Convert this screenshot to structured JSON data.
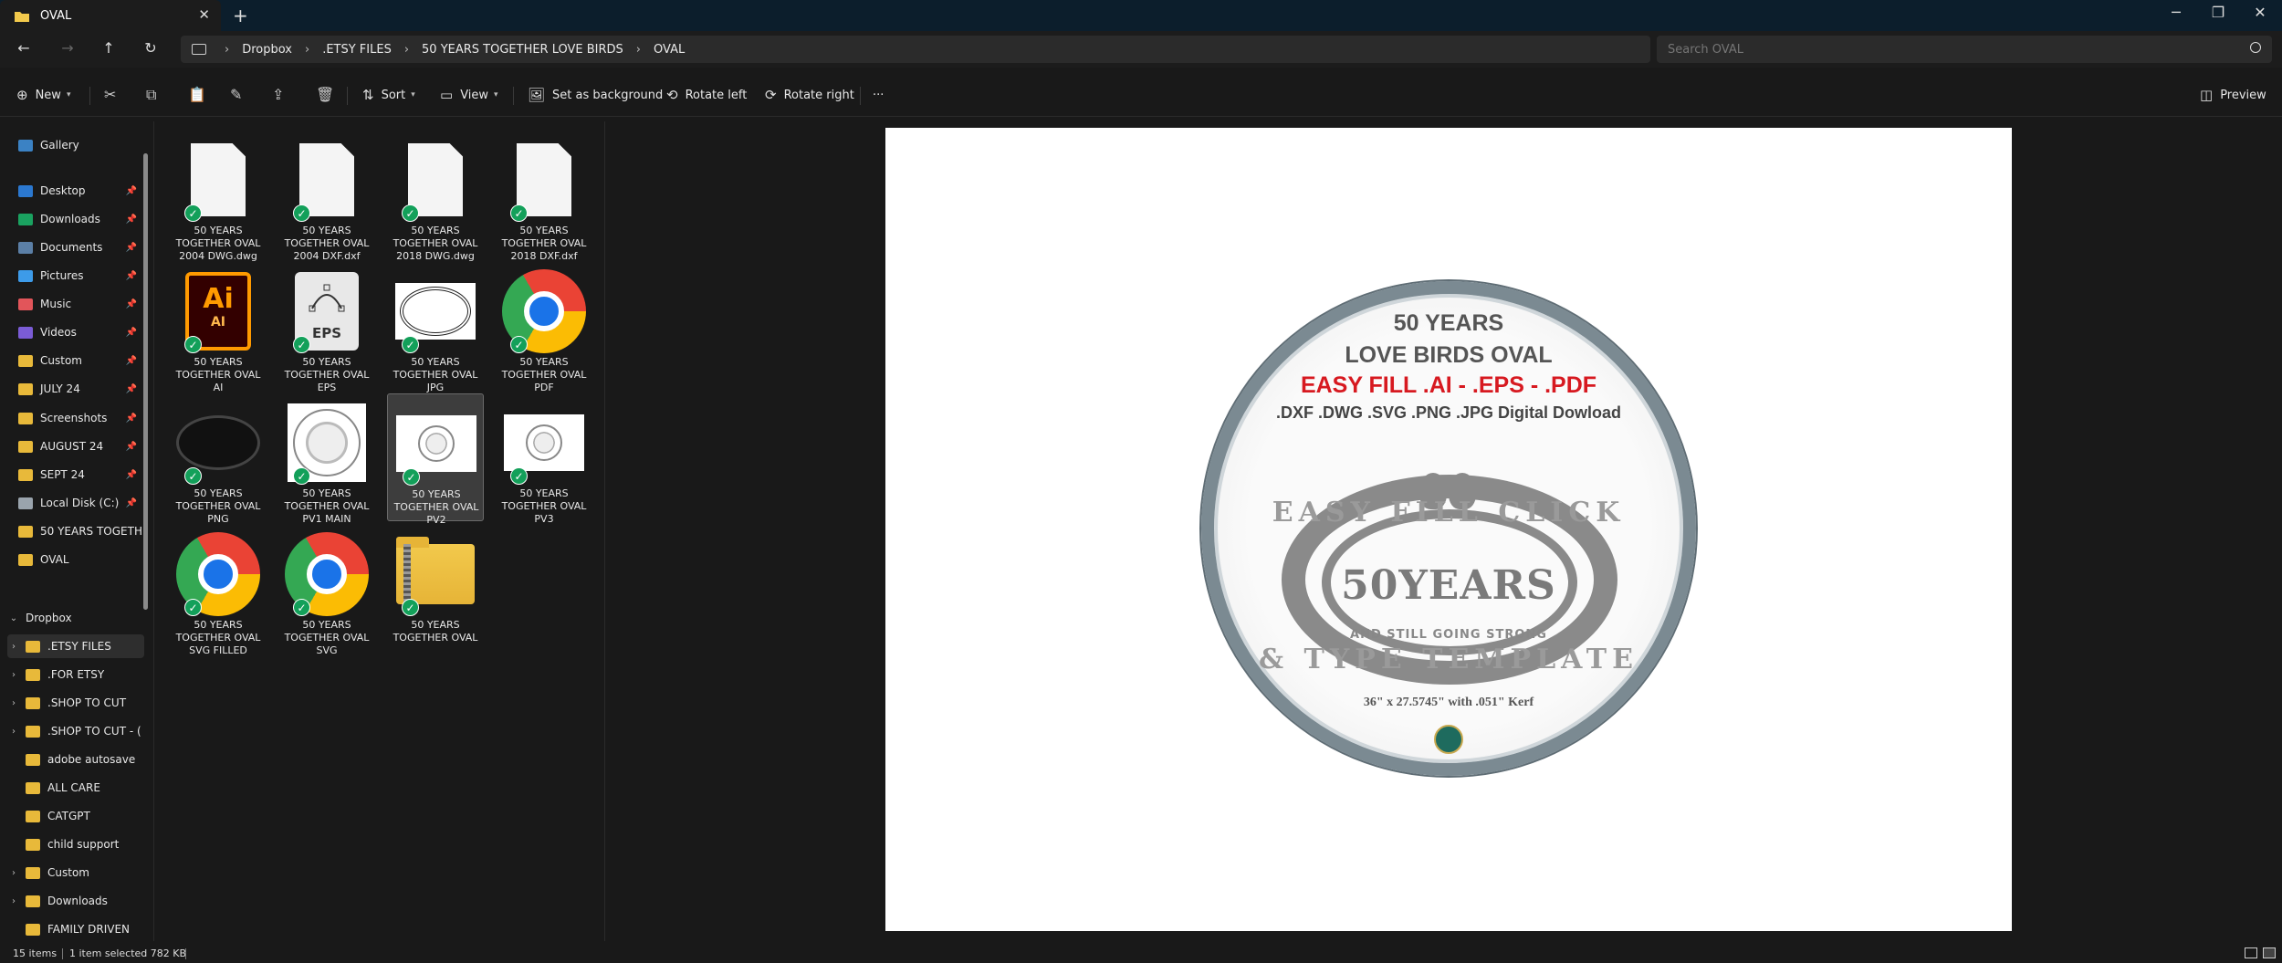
{
  "window": {
    "tab_title": "OVAL",
    "close_tab": "✕",
    "new_tab": "+",
    "minimize": "─",
    "maximize": "❐",
    "close": "✕"
  },
  "address": {
    "crumbs": [
      "Dropbox",
      ".ETSY FILES",
      "50 YEARS TOGETHER LOVE BIRDS",
      "OVAL"
    ],
    "search_placeholder": "Search OVAL"
  },
  "toolbar": {
    "new_label": "New",
    "sort_label": "Sort",
    "view_label": "View",
    "set_background_label": "Set as background",
    "rotate_left_label": "Rotate left",
    "rotate_right_label": "Rotate right",
    "more_label": "···",
    "preview_label": "Preview"
  },
  "sidebar": {
    "items": [
      {
        "label": "Gallery",
        "color": "#3b82c4",
        "pinned": false
      },
      {
        "label": "Desktop",
        "color": "#2b78d0",
        "pinned": true
      },
      {
        "label": "Downloads",
        "color": "#1aa260",
        "pinned": true
      },
      {
        "label": "Documents",
        "color": "#5b7fa6",
        "pinned": true
      },
      {
        "label": "Pictures",
        "color": "#3d9be9",
        "pinned": true
      },
      {
        "label": "Music",
        "color": "#e2555a",
        "pinned": true
      },
      {
        "label": "Videos",
        "color": "#7b5cd6",
        "pinned": true
      },
      {
        "label": "Custom",
        "color": "#e8b93a",
        "pinned": true
      },
      {
        "label": "JULY 24",
        "color": "#e8b93a",
        "pinned": true
      },
      {
        "label": "Screenshots",
        "color": "#e8b93a",
        "pinned": true
      },
      {
        "label": "AUGUST 24",
        "color": "#e8b93a",
        "pinned": true
      },
      {
        "label": "SEPT 24",
        "color": "#e8b93a",
        "pinned": true
      },
      {
        "label": "Local Disk (C:)",
        "color": "#9aa4ad",
        "pinned": true
      },
      {
        "label": "50 YEARS TOGETHI",
        "color": "#e8b93a",
        "pinned": false
      },
      {
        "label": "OVAL",
        "color": "#e8b93a",
        "pinned": false
      }
    ],
    "dropbox_label": "Dropbox",
    "tree": [
      {
        "label": ".ETSY FILES",
        "expandable": true,
        "selected": true
      },
      {
        "label": ".FOR ETSY",
        "expandable": true,
        "selected": false
      },
      {
        "label": ".SHOP TO CUT",
        "expandable": true,
        "selected": false
      },
      {
        "label": ".SHOP TO CUT - (",
        "expandable": true,
        "selected": false
      },
      {
        "label": "adobe autosave",
        "expandable": false,
        "selected": false
      },
      {
        "label": "ALL CARE",
        "expandable": false,
        "selected": false
      },
      {
        "label": "CATGPT",
        "expandable": false,
        "selected": false
      },
      {
        "label": "child support",
        "expandable": false,
        "selected": false
      },
      {
        "label": "Custom",
        "expandable": true,
        "selected": false
      },
      {
        "label": "Downloads",
        "expandable": true,
        "selected": false
      },
      {
        "label": "FAMILY DRIVEN",
        "expandable": false,
        "selected": false
      }
    ]
  },
  "files": [
    {
      "name": "50 YEARS\nTOGETHER OVAL\n2004 DWG.dwg",
      "kind": "doc"
    },
    {
      "name": "50 YEARS\nTOGETHER OVAL\n2004 DXF.dxf",
      "kind": "doc"
    },
    {
      "name": "50 YEARS\nTOGETHER OVAL\n2018 DWG.dwg",
      "kind": "doc"
    },
    {
      "name": "50 YEARS\nTOGETHER OVAL\n2018 DXF.dxf",
      "kind": "doc"
    },
    {
      "name": "50 YEARS\nTOGETHER OVAL\nAI",
      "kind": "ai"
    },
    {
      "name": "50 YEARS\nTOGETHER OVAL\nEPS",
      "kind": "eps"
    },
    {
      "name": "50 YEARS\nTOGETHER OVAL\nJPG",
      "kind": "oval-light"
    },
    {
      "name": "50 YEARS\nTOGETHER OVAL\nPDF",
      "kind": "chrome"
    },
    {
      "name": "50 YEARS\nTOGETHER OVAL\nPNG",
      "kind": "oval-dark"
    },
    {
      "name": "50 YEARS\nTOGETHER OVAL\nPV1 MAIN",
      "kind": "pv1"
    },
    {
      "name": "50 YEARS\nTOGETHER OVAL\nPV2",
      "kind": "pvs",
      "selected": true
    },
    {
      "name": "50 YEARS\nTOGETHER OVAL\nPV3",
      "kind": "pvs"
    },
    {
      "name": "50 YEARS\nTOGETHER OVAL\nSVG FILLED",
      "kind": "chrome"
    },
    {
      "name": "50 YEARS\nTOGETHER OVAL\nSVG",
      "kind": "chrome"
    },
    {
      "name": "50 YEARS\nTOGETHER OVAL",
      "kind": "zip"
    }
  ],
  "ai_icon": {
    "big": "Ai",
    "small": "AI"
  },
  "eps_icon": {
    "label": "EPS"
  },
  "preview": {
    "line1": "50 YEARS",
    "line2": "LOVE BIRDS OVAL",
    "line3": "EASY FILL .AI - .EPS - .PDF",
    "line4": ".DXF .DWG .SVG .PNG .JPG Digital Dowload",
    "arc_top": "EASY FILL CLICK",
    "big_years": "50YEARS",
    "still_going": "AND STILL GOING STRONG",
    "arc_bottom": "& TYPE TEMPLATE",
    "kerf": "36\" x 27.5745\" with .051\" Kerf"
  },
  "status": {
    "items_count": "15 items",
    "selected": "1 item selected  782 KB"
  }
}
